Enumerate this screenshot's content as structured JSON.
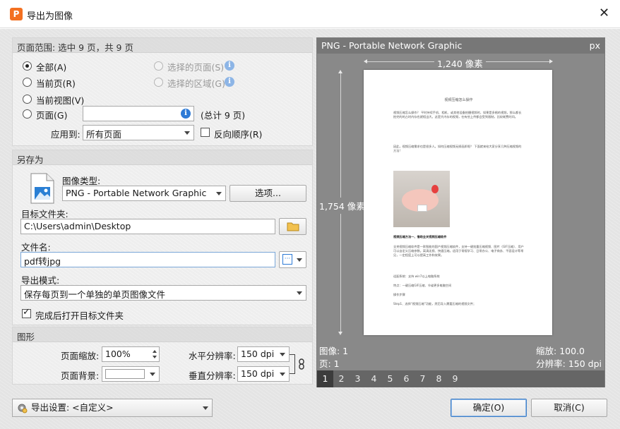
{
  "window": {
    "title": "导出为图像",
    "close": "✕"
  },
  "range": {
    "heading": "页面范围: 选中 9 页，共 9 页",
    "all": "全部(A)",
    "current_page": "当前页(R)",
    "current_view": "当前视图(V)",
    "pages": "页面(G)",
    "selected_pages": "选择的页面(S)",
    "selected_area": "选择的区域(G)",
    "pages_value": "",
    "total": "(总计 9 页)",
    "apply_label": "应用到:",
    "apply_value": "所有页面",
    "reverse": "反向顺序(R)"
  },
  "saveas": {
    "heading": "另存为",
    "image_type_label": "图像类型:",
    "image_type": "PNG - Portable Network Graphic",
    "options": "选项...",
    "folder_label": "目标文件夹:",
    "folder": "C:\\Users\\admin\\Desktop",
    "filename_label": "文件名:",
    "filename": "pdf转jpg",
    "mode_label": "导出模式:",
    "mode": "保存每页到一个单独的单页图像文件",
    "open_after": "完成后打开目标文件夹"
  },
  "graphics": {
    "heading": "图形",
    "zoom_label": "页面缩放:",
    "zoom": "100%",
    "bg_label": "页面背景:",
    "hres_label": "水平分辨率:",
    "hres": "150 dpi",
    "vres_label": "垂直分辨率:",
    "vres": "150 dpi"
  },
  "preview": {
    "title": "PNG - Portable Network Graphic",
    "unit": "px",
    "width": "1,240 像素",
    "height": "1,754 像素",
    "image_label": "图像: 1",
    "page_label": "页: 1",
    "zoom_label": "缩放: 100.0",
    "res_label": "分辨率: 150 dpi",
    "tabs": [
      "1",
      "2",
      "3",
      "4",
      "5",
      "6",
      "7",
      "8",
      "9"
    ],
    "doc": {
      "title": "视频压缩怎么操作",
      "p1": "视频压缩怎么操作？ 平时持续手机、相机、或其他设备拍摄视频时，如果是多格的视频，那么都长拍完的的占时内存也就相当大。这是大内存的视频，在有些上传都会受到限制，比较耗费时间。",
      "p2": "因此，视频压缩需求也是很多人。如何压缩视频无损画质呢？ 下面就来给大家分享几种压缩视频的方法!",
      "h1": "视频压缩方法一、借助全关视频压缩软件",
      "p3": "全关视频压缩软件是一款智能的国产视频压缩软件，支持一键批量压缩视频、图片（GIF压缩）、用户可以自定义压缩参数。离清无损、快速压缩。适用于常规学习、日常办公、电子商务、平面设计等常见，一定程度上可以提高工作和效果。",
      "p4": "适配系统：支持 win7以上电脑系统",
      "p5": "特点：一键压缩GIF压缩、节省更多电脑空间",
      "p6": "操作步骤",
      "p7": "Step1、选择“视频压缩”功能，然后导入需要压缩的视频文件；"
    }
  },
  "footer": {
    "export_settings": "导出设置: <自定义>",
    "ok": "确定(O)",
    "cancel": "取消(C)"
  }
}
